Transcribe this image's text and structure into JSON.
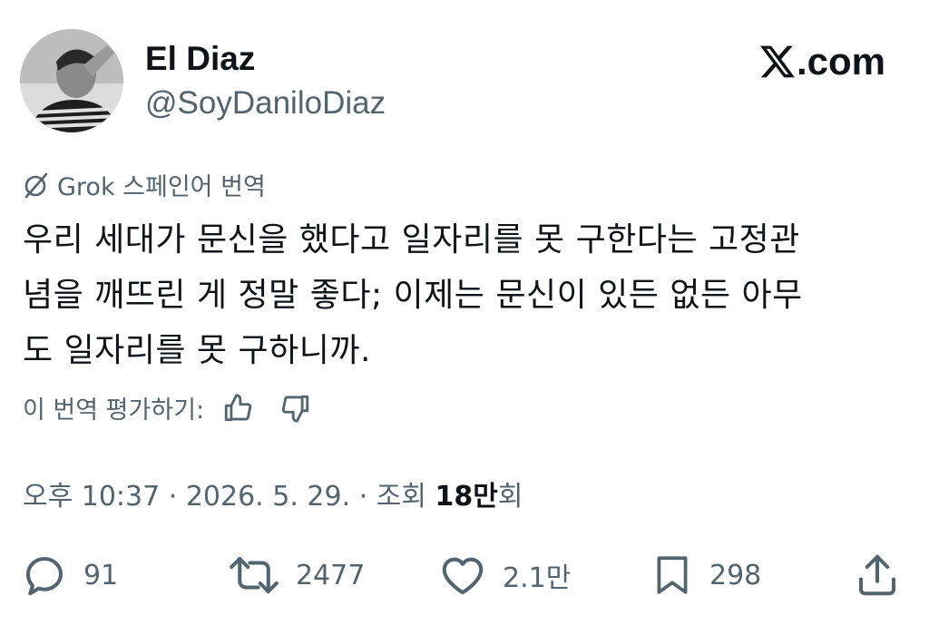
{
  "author": {
    "name": "El Diaz",
    "handle": "@SoyDaniloDiaz"
  },
  "site": {
    "label": ".com",
    "icon": "x-logo-icon"
  },
  "translation": {
    "label": "Grok 스페인어 번역",
    "icon": "grok-icon"
  },
  "tweet": {
    "line1": "우리 세대가 문신을 했다고 일자리를 못 구한다는 고정관",
    "line2": "념을 깨뜨린 게 정말 좋다; 이제는 문신이 있든 없든 아무",
    "line3": "도 일자리를 못 구하니까."
  },
  "rating": {
    "label": "이 번역 평가하기:"
  },
  "meta": {
    "time": "오후 10:37",
    "sep": " · ",
    "date": "2026. 5. 29.",
    "views_prefix": "조회 ",
    "views_count": "18만",
    "views_suffix": "회"
  },
  "actions": {
    "replies": "91",
    "reposts": "2477",
    "likes": "2.1만",
    "bookmarks": "298"
  },
  "colors": {
    "text": "#0f1419",
    "secondary": "#536471"
  }
}
